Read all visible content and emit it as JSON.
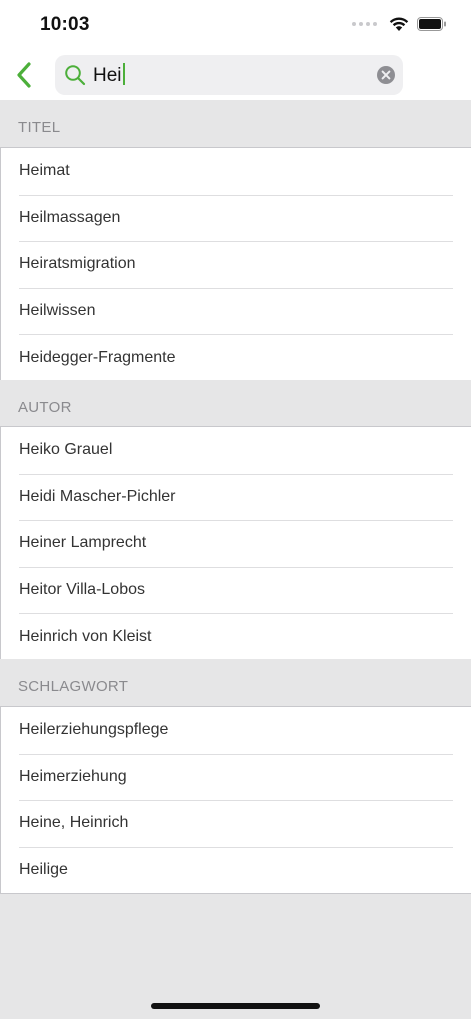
{
  "status_bar": {
    "time": "10:03"
  },
  "search": {
    "query": "Hei"
  },
  "sections": [
    {
      "header": "TITEL",
      "items": [
        "Heimat",
        "Heilmassagen",
        "Heiratsmigration",
        "Heilwissen",
        "Heidegger-Fragmente"
      ]
    },
    {
      "header": "AUTOR",
      "items": [
        "Heiko Grauel",
        "Heidi Mascher-Pichler",
        "Heiner Lamprecht",
        "Heitor Villa-Lobos",
        "Heinrich von Kleist"
      ]
    },
    {
      "header": "SCHLAGWORT",
      "items": [
        "Heilerziehungspflege",
        "Heimerziehung",
        "Heine, Heinrich",
        "Heilige"
      ]
    }
  ],
  "colors": {
    "accent": "#4caf3a",
    "section_bg": "#e6e6e7",
    "list_bg": "#ffffff"
  }
}
